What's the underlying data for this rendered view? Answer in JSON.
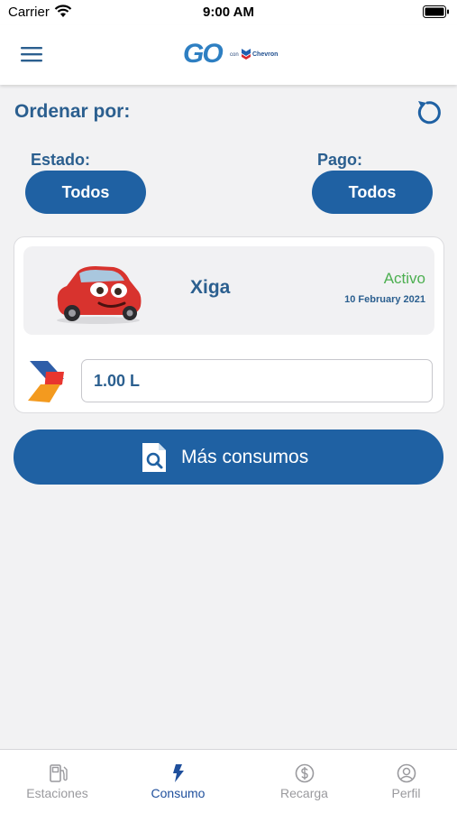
{
  "status_bar": {
    "carrier": "Carrier",
    "time": "9:00 AM"
  },
  "header": {
    "logo": {
      "go": "GO",
      "con": "con",
      "brand": "Chevron"
    }
  },
  "filters": {
    "title": "Ordenar por:",
    "estado": {
      "label": "Estado:",
      "value": "Todos"
    },
    "pago": {
      "label": "Pago:",
      "value": "Todos"
    }
  },
  "vehicle_card": {
    "name": "Xiga",
    "status": "Activo",
    "date": "10 February 2021",
    "liters": "1.00 L"
  },
  "more_button": {
    "label": "Más consumos"
  },
  "tabs": [
    {
      "label": "Estaciones",
      "icon": "fuel-pump-icon",
      "active": false
    },
    {
      "label": "Consumo",
      "icon": "lightning-icon",
      "active": true
    },
    {
      "label": "Recarga",
      "icon": "dollar-circle-icon",
      "active": false
    },
    {
      "label": "Perfil",
      "icon": "user-circle-icon",
      "active": false
    }
  ],
  "colors": {
    "primary": "#1f61a3",
    "title_blue": "#2b5f8f",
    "status_green": "#4caf50",
    "background": "#f2f2f3"
  }
}
